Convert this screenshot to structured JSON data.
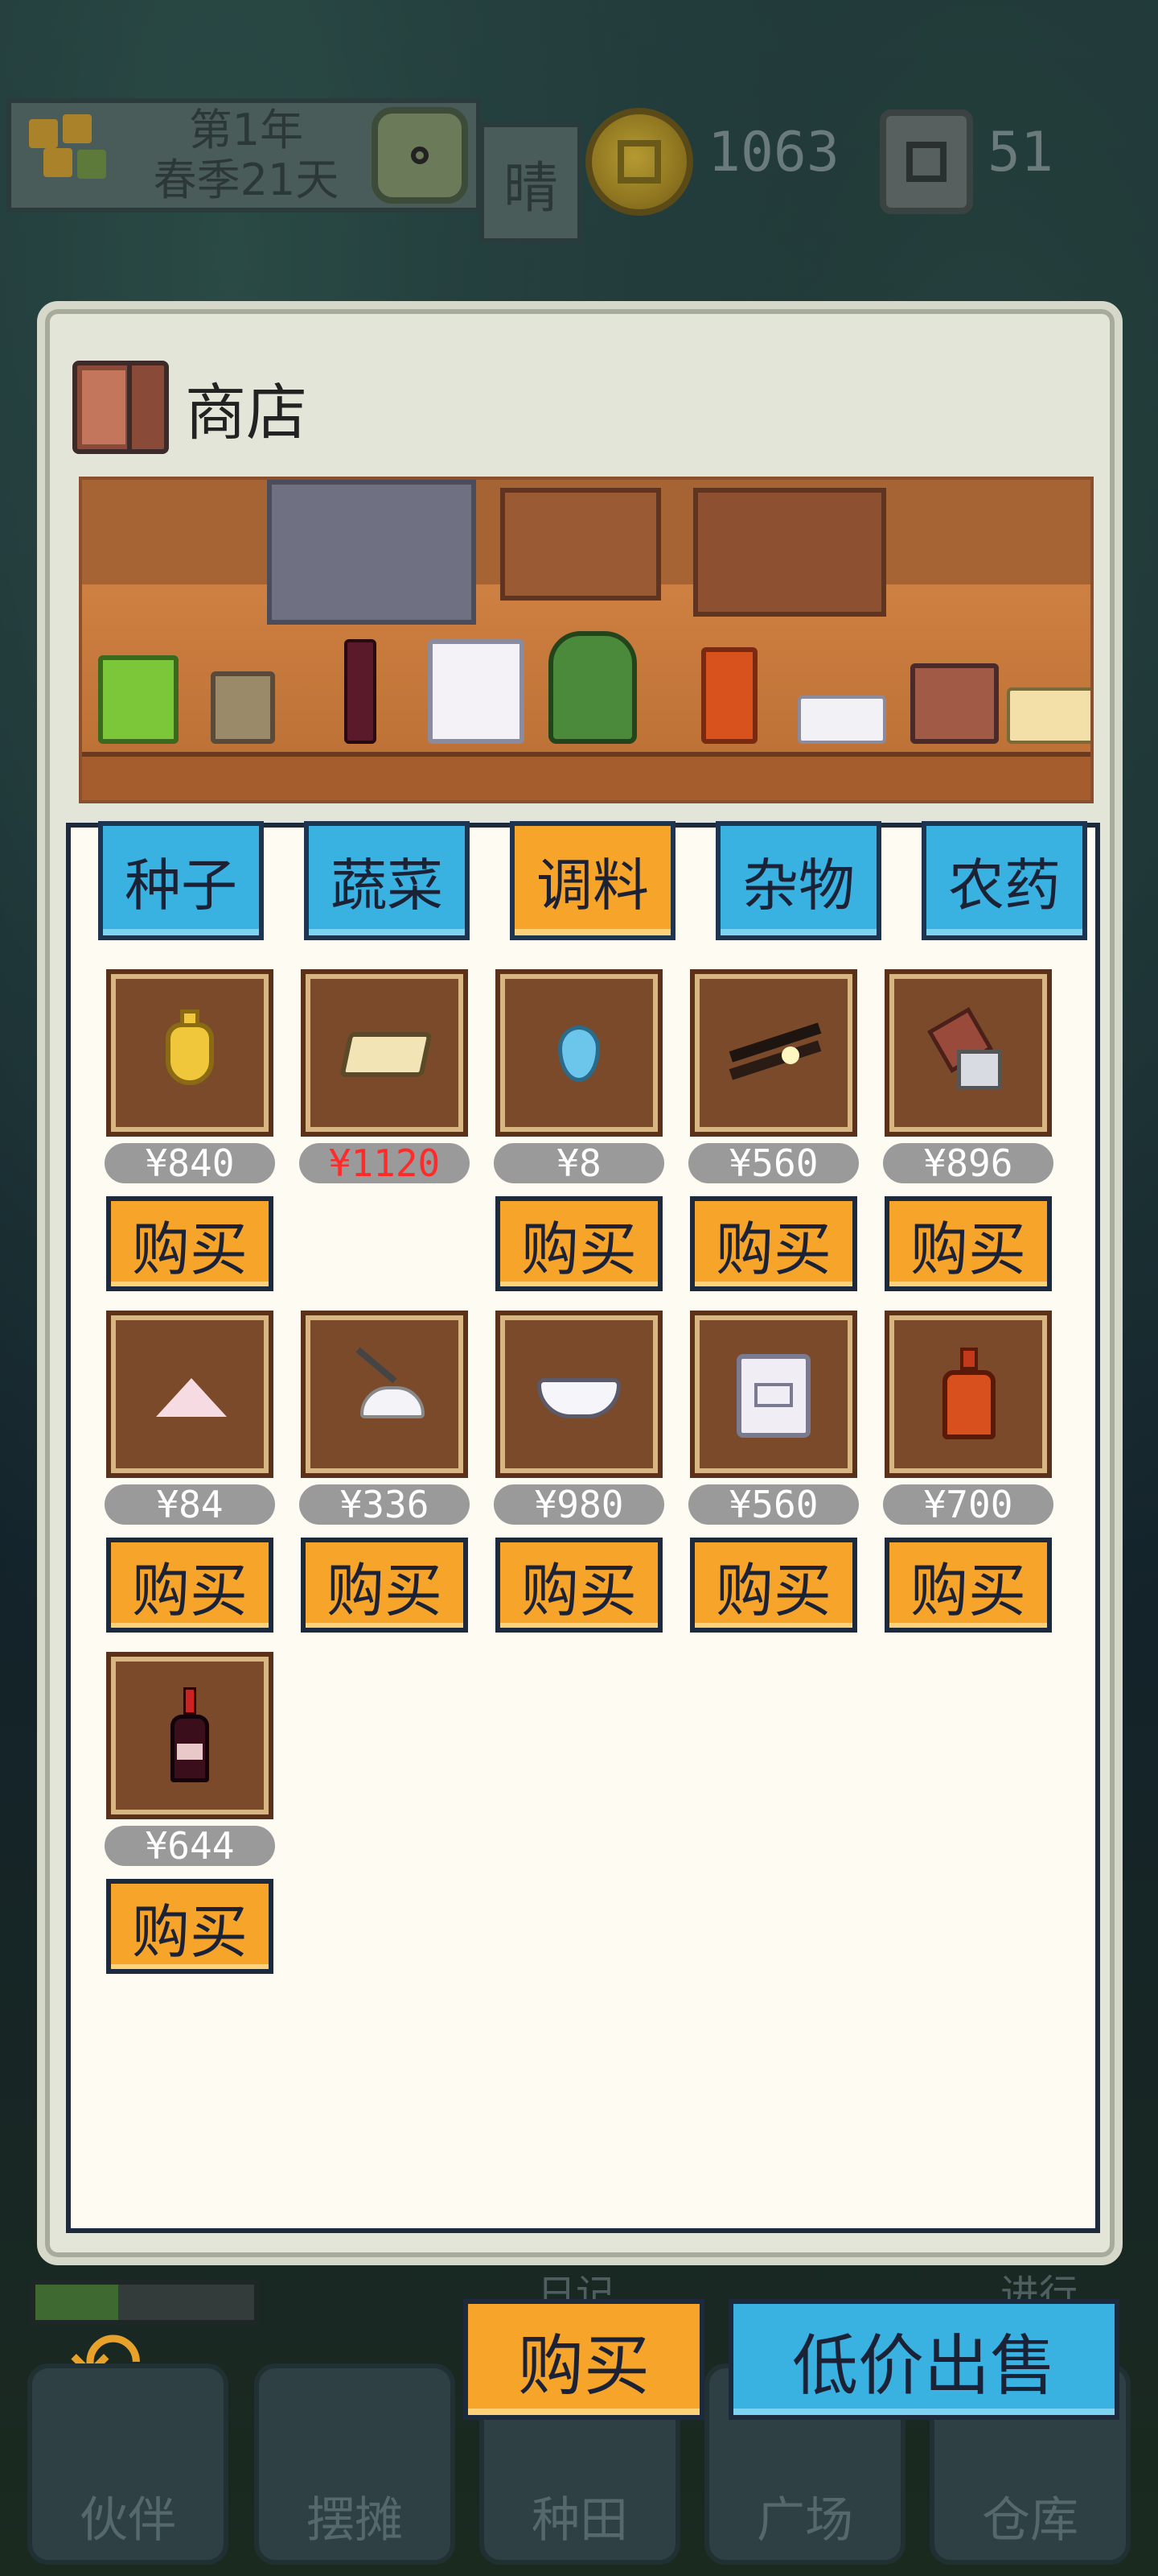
{
  "hud": {
    "date_line1": "第1年",
    "date_line2": "春季21天",
    "weather": "晴",
    "money": "1063",
    "gems": "51"
  },
  "shop": {
    "title": "商店",
    "tabs": [
      {
        "label": "种子",
        "active": false
      },
      {
        "label": "蔬菜",
        "active": false
      },
      {
        "label": "调料",
        "active": true
      },
      {
        "label": "杂物",
        "active": false
      },
      {
        "label": "农药",
        "active": false
      }
    ],
    "items": [
      {
        "price": "¥840",
        "buy": "购买",
        "icon": "oil-jug-icon",
        "affordable": true
      },
      {
        "price": "¥1120",
        "buy": "",
        "icon": "butter-block-icon",
        "affordable": false
      },
      {
        "price": "¥8",
        "buy": "购买",
        "icon": "water-drop-icon",
        "affordable": true
      },
      {
        "price": "¥560",
        "buy": "购买",
        "icon": "vanilla-pods-icon",
        "affordable": true
      },
      {
        "price": "¥896",
        "buy": "购买",
        "icon": "pepper-grinder-icon",
        "affordable": true
      },
      {
        "price": "¥84",
        "buy": "购买",
        "icon": "salt-pile-icon",
        "affordable": true
      },
      {
        "price": "¥336",
        "buy": "购买",
        "icon": "sugar-scoop-icon",
        "affordable": true
      },
      {
        "price": "¥980",
        "buy": "购买",
        "icon": "flour-bowl-icon",
        "affordable": true
      },
      {
        "price": "¥560",
        "buy": "购买",
        "icon": "flour-sack-icon",
        "affordable": true
      },
      {
        "price": "¥700",
        "buy": "购买",
        "icon": "soy-sauce-bottle-icon",
        "affordable": true
      },
      {
        "price": "¥644",
        "buy": "购买",
        "icon": "wine-bottle-icon",
        "affordable": true
      }
    ],
    "actions": {
      "buy": "购买",
      "sell": "低价出售"
    }
  },
  "bottom": {
    "diary": "日记",
    "ongoing": "进行",
    "nav": [
      "伙伴",
      "摆摊",
      "种田",
      "广场",
      "仓库"
    ],
    "progress": 0.38
  },
  "colors": {
    "tab_blue": "#39b2e2",
    "tab_orange": "#f7a52a",
    "price_red": "#ff2a2a"
  }
}
